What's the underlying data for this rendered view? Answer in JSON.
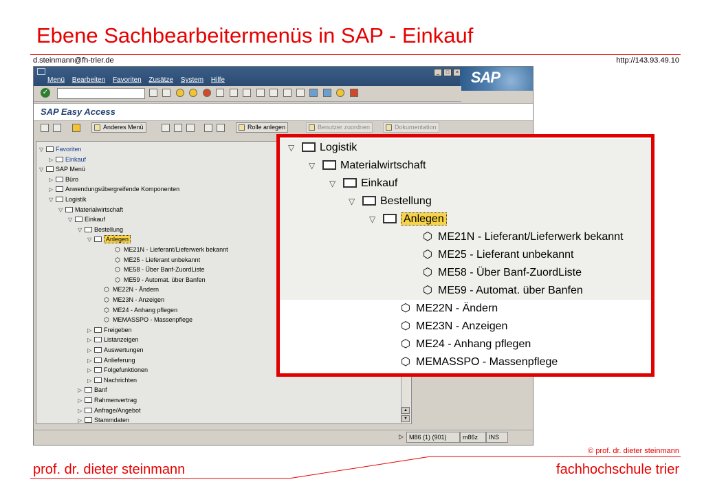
{
  "slide": {
    "title": "Ebene Sachbearbeitermenüs in SAP - Einkauf",
    "email": "d.steinmann@fh-trier.de",
    "url": "http://143.93.49.10",
    "copyright": "© prof. dr. dieter steinmann",
    "author": "prof. dr. dieter steinmann",
    "school": "fachhochschule trier"
  },
  "colors": {
    "accent": "#e60000",
    "sap_title_bar": "#2a4a72",
    "selection": "#f8d347"
  },
  "sap": {
    "logo": "SAP",
    "menu": [
      "Menü",
      "Bearbeiten",
      "Favoriten",
      "Zusätze",
      "System",
      "Hilfe"
    ],
    "screen_title": "SAP Easy Access",
    "toolbar": {
      "anderes_menu": "Anderes Menü",
      "rolle_anlegen": "Rolle anlegen",
      "benutzer_zuordnen": "Benutzer zuordnen",
      "dokumentation": "Dokumentation"
    },
    "tree": [
      {
        "label": "Favoriten",
        "exp": "▽",
        "icon": "folder"
      },
      {
        "label": "Einkauf",
        "exp": "▷",
        "icon": "folder"
      },
      {
        "label": "SAP Menü",
        "exp": "▽",
        "icon": "folder"
      },
      {
        "label": "Büro",
        "exp": "▷",
        "icon": "folder"
      },
      {
        "label": "Anwendungsübergreifende Komponenten",
        "exp": "▷",
        "icon": "folder"
      },
      {
        "label": "Logistik",
        "exp": "▽",
        "icon": "folder"
      },
      {
        "label": "Materialwirtschaft",
        "exp": "▽",
        "icon": "folder"
      },
      {
        "label": "Einkauf",
        "exp": "▽",
        "icon": "folder"
      },
      {
        "label": "Bestellung",
        "exp": "▽",
        "icon": "folder"
      },
      {
        "label": "Anlegen",
        "exp": "▽",
        "icon": "folder"
      },
      {
        "label": "ME21N - Lieferant/Lieferwerk bekannt",
        "exp": "",
        "icon": "cube"
      },
      {
        "label": "ME25 - Lieferant unbekannt",
        "exp": "",
        "icon": "cube"
      },
      {
        "label": "ME58 - Über Banf-ZuordListe",
        "exp": "",
        "icon": "cube"
      },
      {
        "label": "ME59 - Automat. über Banfen",
        "exp": "",
        "icon": "cube"
      },
      {
        "label": "ME22N - Ändern",
        "exp": "",
        "icon": "cube"
      },
      {
        "label": "ME23N - Anzeigen",
        "exp": "",
        "icon": "cube"
      },
      {
        "label": "ME24 - Anhang pflegen",
        "exp": "",
        "icon": "cube"
      },
      {
        "label": "MEMASSPO - Massenpflege",
        "exp": "",
        "icon": "cube"
      },
      {
        "label": "Freigeben",
        "exp": "▷",
        "icon": "folder"
      },
      {
        "label": "Listanzeigen",
        "exp": "▷",
        "icon": "folder"
      },
      {
        "label": "Auswertungen",
        "exp": "▷",
        "icon": "folder"
      },
      {
        "label": "Anlieferung",
        "exp": "▷",
        "icon": "folder"
      },
      {
        "label": "Folgefunktionen",
        "exp": "▷",
        "icon": "folder"
      },
      {
        "label": "Nachrichten",
        "exp": "▷",
        "icon": "folder"
      },
      {
        "label": "Banf",
        "exp": "▷",
        "icon": "folder"
      },
      {
        "label": "Rahmenvertrag",
        "exp": "▷",
        "icon": "folder"
      },
      {
        "label": "Anfrage/Angebot",
        "exp": "▷",
        "icon": "folder"
      },
      {
        "label": "Stammdaten",
        "exp": "▷",
        "icon": "folder"
      }
    ],
    "status": {
      "session": "M86 (1) (901)",
      "server": "m86z",
      "mode": "INS"
    }
  },
  "zoom": {
    "rows": [
      {
        "label": "Logistik",
        "exp": "▽",
        "icon": "folder"
      },
      {
        "label": "Materialwirtschaft",
        "exp": "▽",
        "icon": "folder"
      },
      {
        "label": "Einkauf",
        "exp": "▽",
        "icon": "folder"
      },
      {
        "label": "Bestellung",
        "exp": "▽",
        "icon": "folder"
      },
      {
        "label": "Anlegen",
        "exp": "▽",
        "icon": "folder"
      },
      {
        "label": "ME21N - Lieferant/Lieferwerk bekannt",
        "exp": "",
        "icon": "cube"
      },
      {
        "label": "ME25 - Lieferant unbekannt",
        "exp": "",
        "icon": "cube"
      },
      {
        "label": "ME58 - Über Banf-ZuordListe",
        "exp": "",
        "icon": "cube"
      },
      {
        "label": "ME59 - Automat. über Banfen",
        "exp": "",
        "icon": "cube"
      },
      {
        "label": "ME22N - Ändern",
        "exp": "",
        "icon": "cube"
      },
      {
        "label": "ME23N - Anzeigen",
        "exp": "",
        "icon": "cube"
      },
      {
        "label": "ME24 - Anhang pflegen",
        "exp": "",
        "icon": "cube"
      },
      {
        "label": "MEMASSPO - Massenpflege",
        "exp": "",
        "icon": "cube"
      }
    ]
  }
}
